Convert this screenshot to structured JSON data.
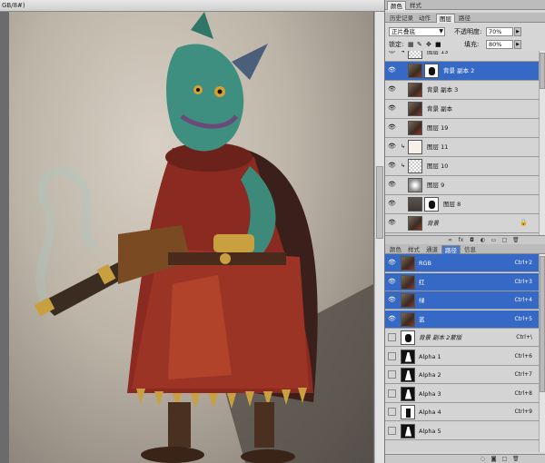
{
  "document": {
    "tab_title": "GB/8#)"
  },
  "top_tabs": [
    "颜色",
    "样式"
  ],
  "layers_tabs": [
    "历史记录",
    "动作",
    "图层",
    "路径"
  ],
  "layers_options": {
    "blend_mode": "正片叠底",
    "opacity_label": "不透明度:",
    "opacity_value": "70%",
    "lock_label": "锁定:",
    "fill_label": "填充:",
    "fill_value": "80%"
  },
  "layers": [
    {
      "name": "图层 13",
      "thumb": "checker",
      "eye": true,
      "selected": false,
      "link": true
    },
    {
      "name": "背景 副本 2",
      "thumb": "pic",
      "mask": true,
      "eye": true,
      "selected": true,
      "link": false
    },
    {
      "name": "背景 副本 3",
      "thumb": "pic",
      "eye": true,
      "selected": false,
      "link": false
    },
    {
      "name": "背景 副本",
      "thumb": "pic",
      "eye": true,
      "selected": false,
      "link": false
    },
    {
      "name": "图层 19",
      "thumb": "pic",
      "eye": true,
      "selected": false,
      "link": false
    },
    {
      "name": "图层 11",
      "thumb": "white",
      "eye": true,
      "selected": false,
      "link": true
    },
    {
      "name": "图层 10",
      "thumb": "checker",
      "eye": true,
      "selected": false,
      "link": true
    },
    {
      "name": "图层 9",
      "thumb": "blur",
      "eye": true,
      "selected": false,
      "link": false
    },
    {
      "name": "图层 8",
      "thumb": "dark",
      "mask": true,
      "eye": true,
      "selected": false,
      "link": false
    },
    {
      "name": "背景",
      "thumb": "pic",
      "eye": true,
      "selected": false,
      "locked": true,
      "italic": true
    }
  ],
  "layers_bottom_icons": [
    "link-icon",
    "fx-icon",
    "mask-icon",
    "adjustment-icon",
    "group-icon",
    "new-layer-icon",
    "trash-icon"
  ],
  "channels_tabs": [
    "颜色",
    "样式",
    "通道",
    "路径",
    "信息"
  ],
  "channels": [
    {
      "name": "RGB",
      "shortcut": "Ctrl+2",
      "thumb": "pic",
      "eye": true,
      "selected": true
    },
    {
      "name": "红",
      "shortcut": "Ctrl+3",
      "thumb": "pic",
      "eye": true,
      "selected": true
    },
    {
      "name": "绿",
      "shortcut": "Ctrl+4",
      "thumb": "pic",
      "eye": true,
      "selected": true
    },
    {
      "name": "蓝",
      "shortcut": "Ctrl+5",
      "thumb": "pic",
      "eye": true,
      "selected": true
    },
    {
      "name": "背景 副本 2蒙版",
      "shortcut": "Ctrl+\\",
      "thumb": "mask",
      "eye": false,
      "selected": false,
      "italic": true
    },
    {
      "name": "Alpha 1",
      "shortcut": "Ctrl+6",
      "thumb": "alphaA",
      "eye": false,
      "selected": false
    },
    {
      "name": "Alpha 2",
      "shortcut": "Ctrl+7",
      "thumb": "alphaA",
      "eye": false,
      "selected": false
    },
    {
      "name": "Alpha 3",
      "shortcut": "Ctrl+8",
      "thumb": "alphaA",
      "eye": false,
      "selected": false
    },
    {
      "name": "Alpha 4",
      "shortcut": "Ctrl+9",
      "thumb": "alphaB",
      "eye": false,
      "selected": false
    },
    {
      "name": "Alpha 5",
      "shortcut": "",
      "thumb": "alphaA",
      "eye": false,
      "selected": false
    }
  ],
  "channels_bottom_icons": [
    "load-selection-icon",
    "save-selection-icon",
    "new-channel-icon",
    "trash-icon"
  ],
  "colors": {
    "selection_blue": "#3569c5",
    "panel_bg": "#d6d6d6"
  }
}
